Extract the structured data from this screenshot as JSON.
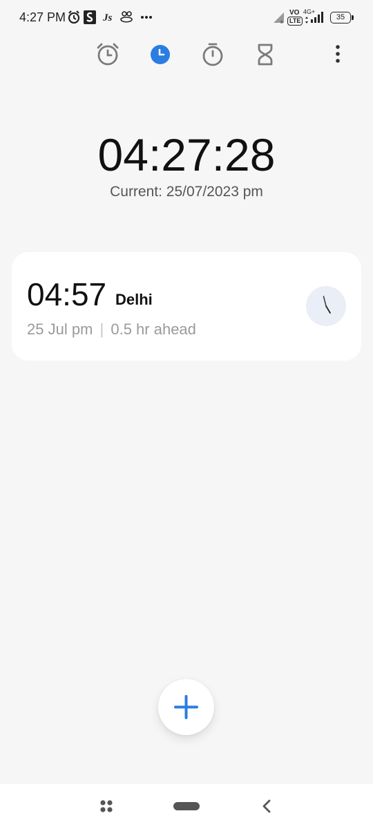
{
  "status_bar": {
    "time": "4:27 PM",
    "network": "4G+",
    "volte": "VO",
    "lte": "LTE",
    "battery": "35"
  },
  "tabs": [
    {
      "name": "alarm",
      "icon": "alarm-clock-icon",
      "active": false
    },
    {
      "name": "clock",
      "icon": "clock-icon",
      "active": true
    },
    {
      "name": "stopwatch",
      "icon": "stopwatch-icon",
      "active": false
    },
    {
      "name": "timer",
      "icon": "hourglass-icon",
      "active": false
    }
  ],
  "main_clock": {
    "time": "04:27:28",
    "date_line": "Current: 25/07/2023 pm"
  },
  "world_clocks": [
    {
      "time": "04:57",
      "city": "Delhi",
      "date": "25 Jul pm",
      "separator": "|",
      "offset": "0.5 hr ahead"
    }
  ],
  "colors": {
    "accent": "#2a7de1",
    "background": "#f6f6f6",
    "card": "#ffffff",
    "muted_text": "#9a9a9a"
  }
}
